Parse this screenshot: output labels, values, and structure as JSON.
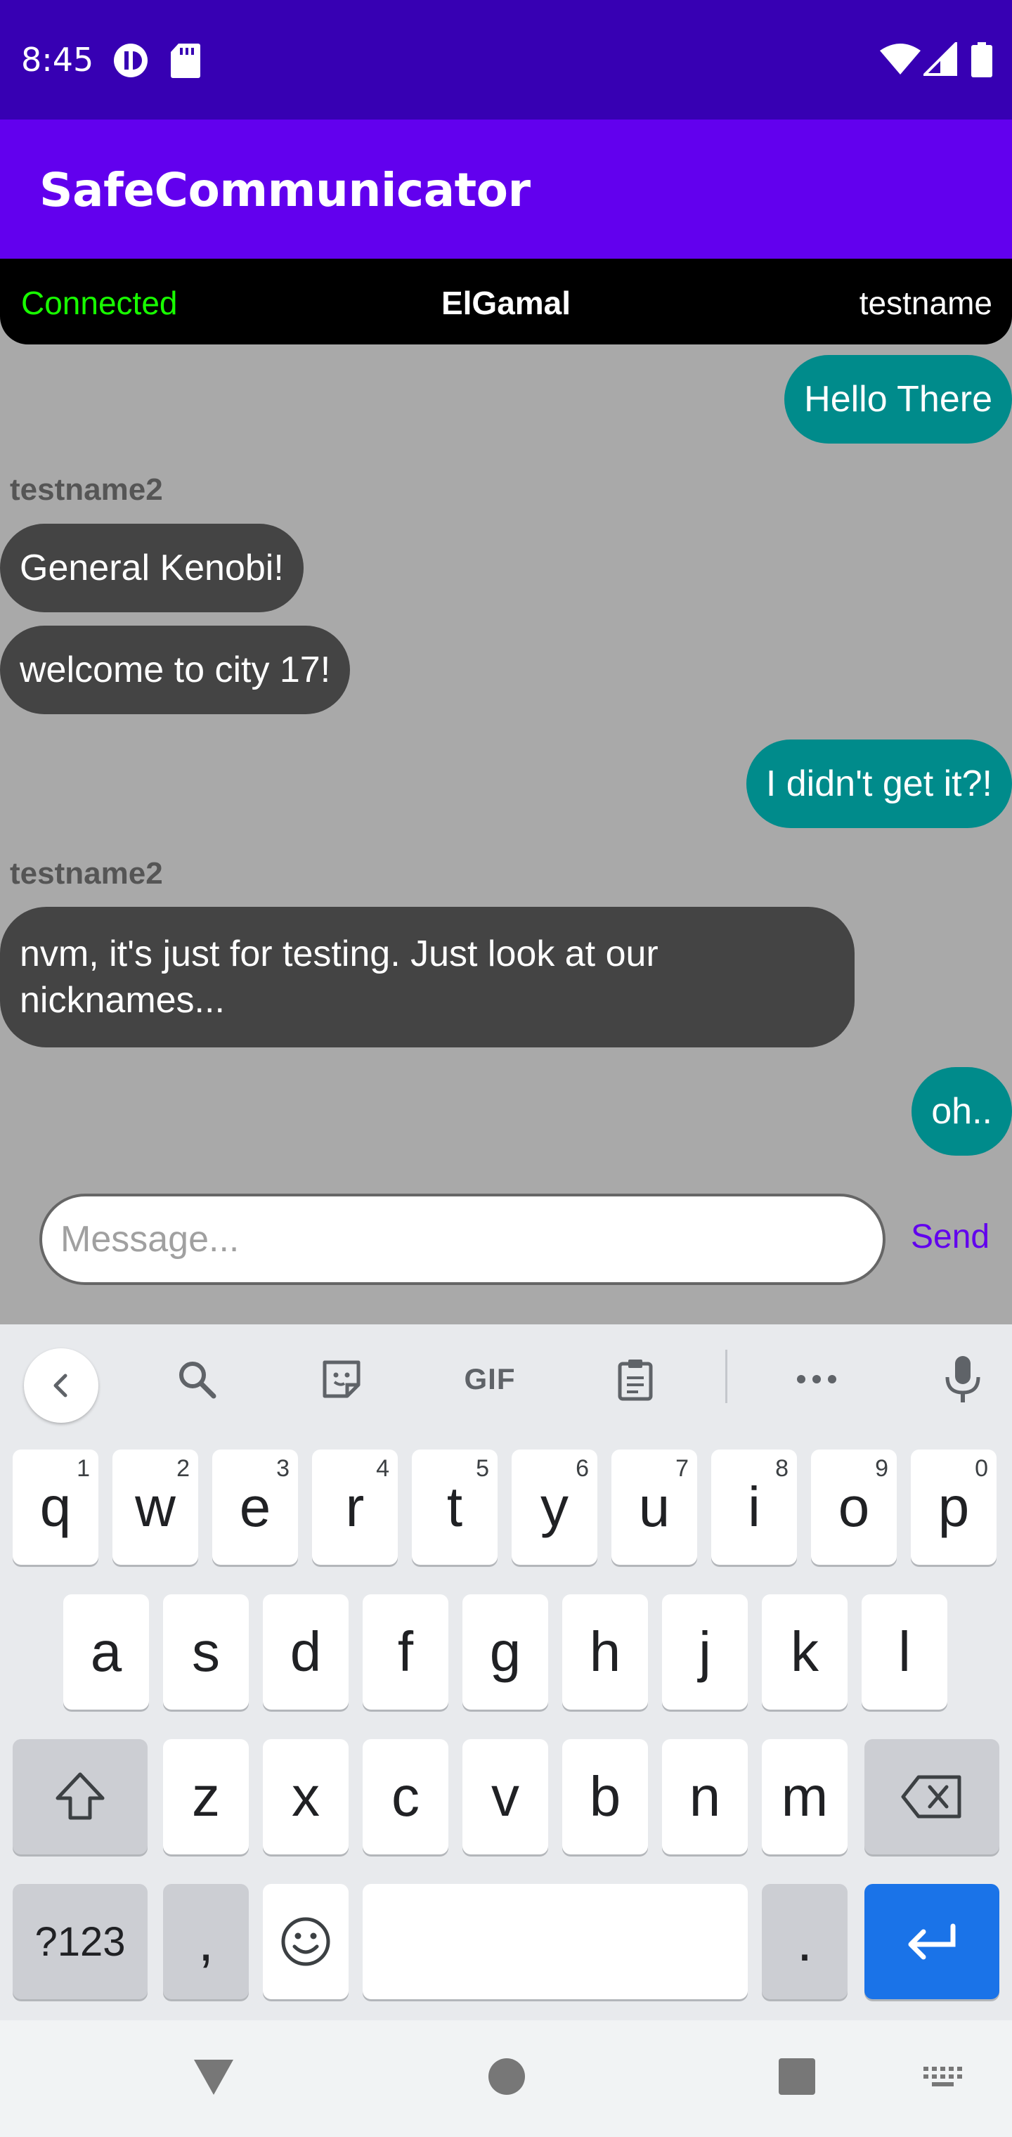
{
  "status_bar": {
    "time": "8:45",
    "icons": [
      "data-saver-icon",
      "sd-card-icon",
      "wifi-icon",
      "signal-icon",
      "battery-icon"
    ]
  },
  "app_bar": {
    "title": "SafeCommunicator"
  },
  "connection": {
    "status": "Connected",
    "algorithm": "ElGamal",
    "username": "testname",
    "status_color": "#18ff00"
  },
  "messages": [
    {
      "type": "sent",
      "text": "Hello There"
    },
    {
      "type": "received",
      "sender": "testname2",
      "text": "General Kenobi!"
    },
    {
      "type": "received",
      "text": "welcome to city 17!"
    },
    {
      "type": "sent",
      "text": "I didn't get it?!"
    },
    {
      "type": "received",
      "sender": "testname2",
      "text": "nvm, it's just for testing. Just look at our nicknames..."
    },
    {
      "type": "sent",
      "text": "oh.."
    }
  ],
  "composer": {
    "placeholder": "Message...",
    "value": "",
    "send_label": "Send"
  },
  "keyboard": {
    "toolbar": [
      "back-icon",
      "search-icon",
      "sticker-icon",
      "GIF",
      "clipboard-icon",
      "more-icon",
      "microphone-icon"
    ],
    "row1": [
      {
        "key": "q",
        "hint": "1"
      },
      {
        "key": "w",
        "hint": "2"
      },
      {
        "key": "e",
        "hint": "3"
      },
      {
        "key": "r",
        "hint": "4"
      },
      {
        "key": "t",
        "hint": "5"
      },
      {
        "key": "y",
        "hint": "6"
      },
      {
        "key": "u",
        "hint": "7"
      },
      {
        "key": "i",
        "hint": "8"
      },
      {
        "key": "o",
        "hint": "9"
      },
      {
        "key": "p",
        "hint": "0"
      }
    ],
    "row2": [
      "a",
      "s",
      "d",
      "f",
      "g",
      "h",
      "j",
      "k",
      "l"
    ],
    "row3": [
      "z",
      "x",
      "c",
      "v",
      "b",
      "n",
      "m"
    ],
    "symbols_label": "?123",
    "comma": ",",
    "period": "."
  },
  "colors": {
    "status_bar": "#3700b3",
    "app_bar": "#6200ee",
    "sent_bubble": "#008b8b",
    "received_bubble": "#444444",
    "chat_background": "#a9a9a9",
    "enter_key": "#1a73e8"
  }
}
